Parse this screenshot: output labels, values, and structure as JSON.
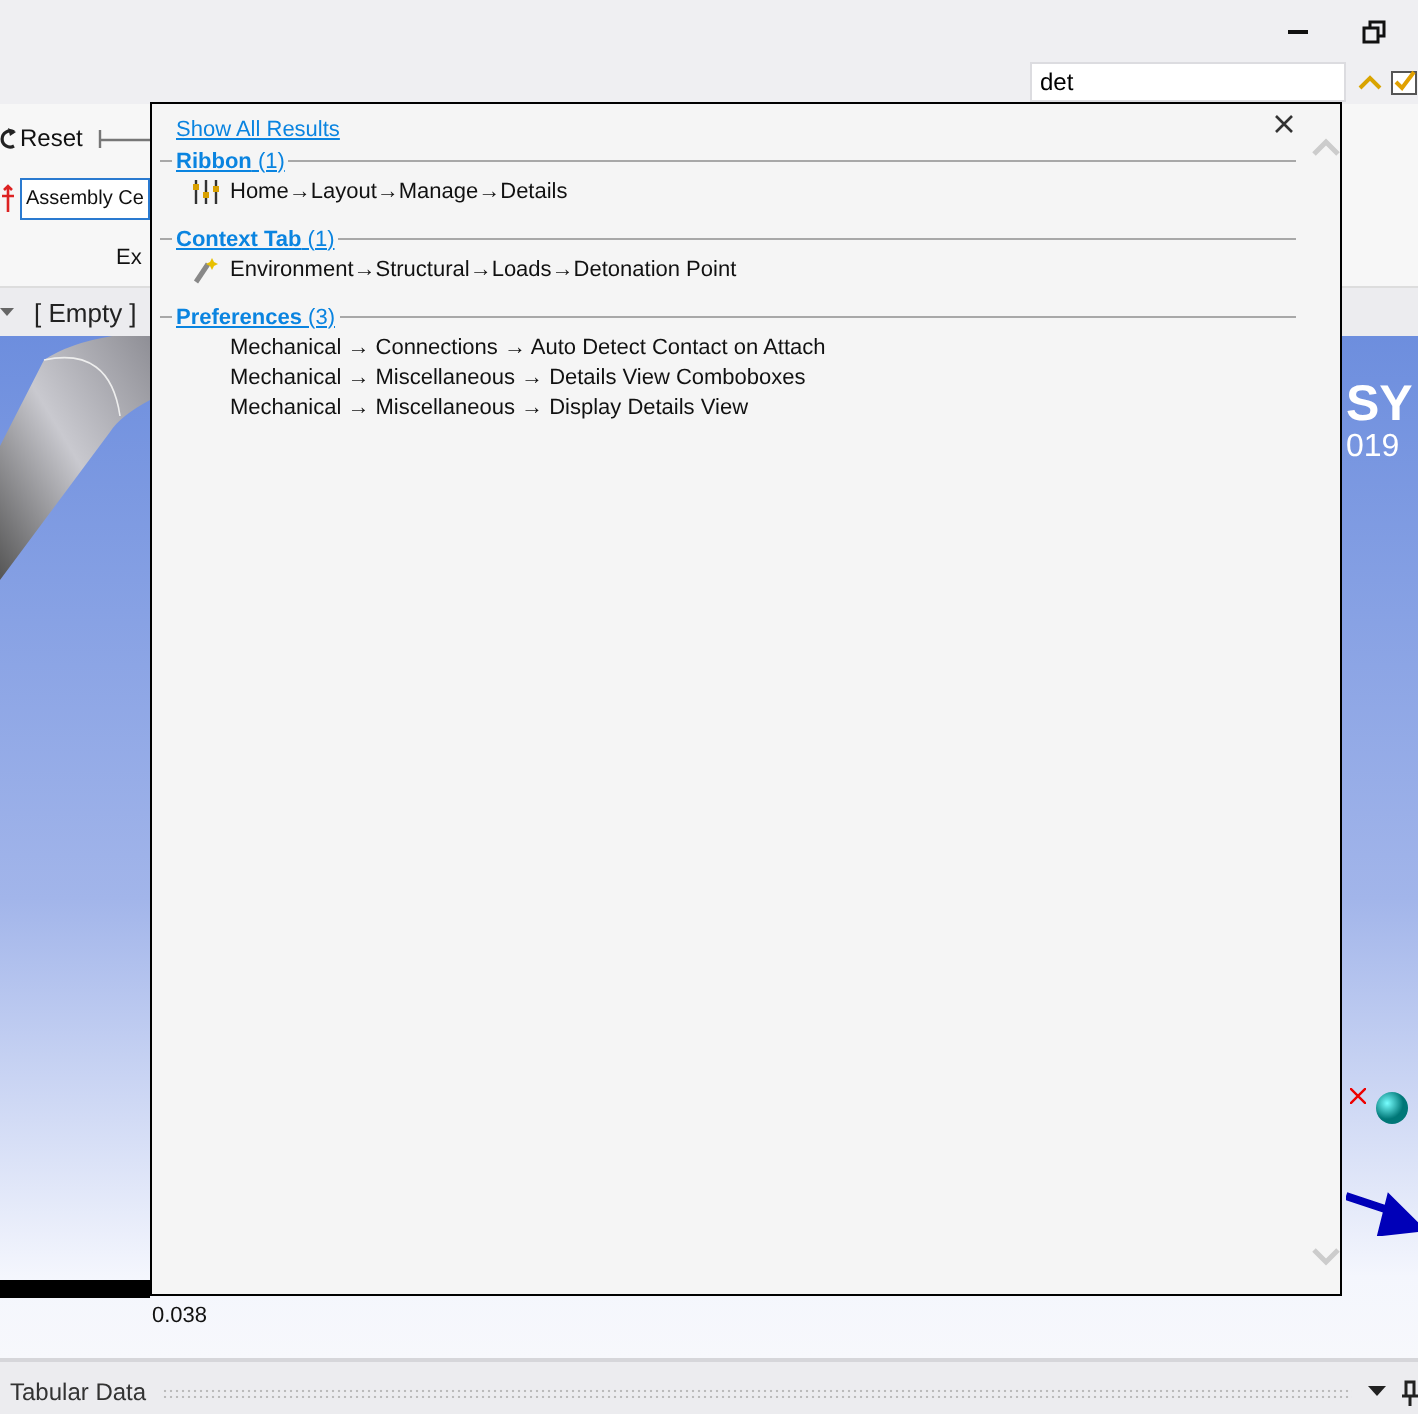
{
  "search": {
    "value": "det"
  },
  "ribbon": {
    "reset_label": "Reset",
    "field_value": "Assembly Ce",
    "group_label": "Ex"
  },
  "toolbar": {
    "selection": "[ Empty ]"
  },
  "viewport": {
    "logo_lines": [
      "SY",
      "019"
    ],
    "scale_label": "0.038"
  },
  "panel": {
    "title": "Tabular Data"
  },
  "popup": {
    "show_all": "Show All Results",
    "groups": [
      {
        "title": "**Ribbon** (1)",
        "items": [
          {
            "kind": "sliders",
            "text": "Home→Layout→Manage→Details"
          }
        ]
      },
      {
        "title": "**Context Tab** (1)",
        "items": [
          {
            "kind": "wand",
            "text": "Environment→Structural→Loads→Detonation Point"
          }
        ]
      },
      {
        "title": "**Preferences** (3)",
        "items": [
          {
            "kind": "plain",
            "text": "Mechanical → Connections → Auto Detect Contact on Attach"
          },
          {
            "kind": "plain",
            "text": "Mechanical → Miscellaneous → Details View Comboboxes"
          },
          {
            "kind": "plain",
            "text": "Mechanical → Miscellaneous → Display Details View"
          }
        ]
      }
    ]
  }
}
